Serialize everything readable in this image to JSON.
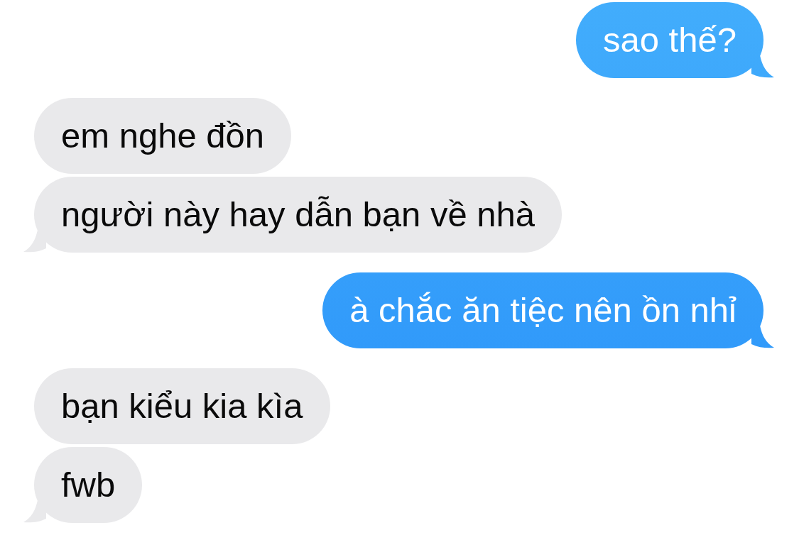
{
  "messages": [
    {
      "text": "sao thế?",
      "kind": "sent",
      "tail": true
    },
    {
      "text": "em nghe đồn",
      "kind": "received",
      "tail": false
    },
    {
      "text": "người này hay dẫn bạn về nhà",
      "kind": "received",
      "tail": true
    },
    {
      "text": "à chắc ăn tiệc nên ồn nhỉ",
      "kind": "sent",
      "tail": true
    },
    {
      "text": "bạn kiểu kia kìa",
      "kind": "received",
      "tail": false
    },
    {
      "text": "fwb",
      "kind": "received",
      "tail": true
    }
  ]
}
